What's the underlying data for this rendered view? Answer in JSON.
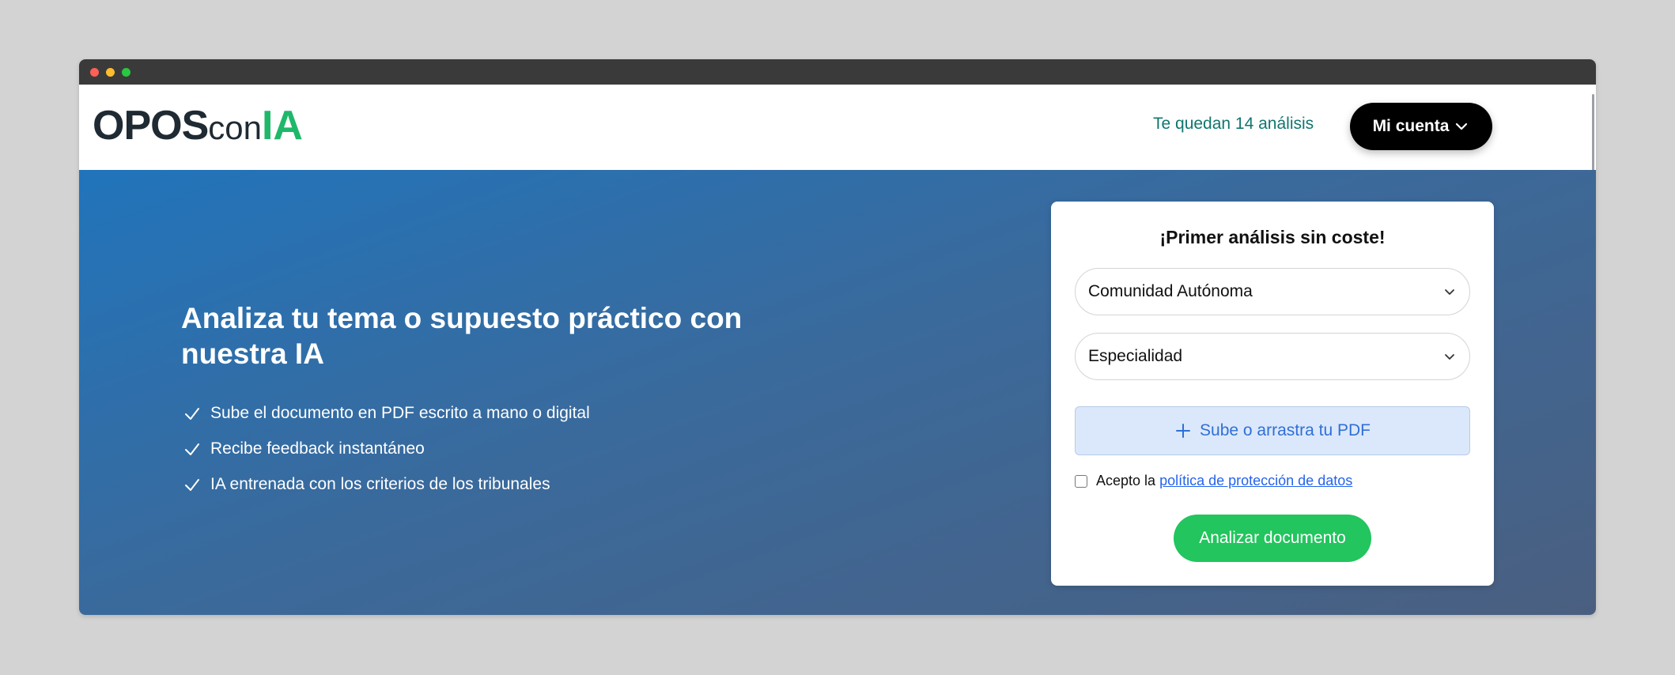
{
  "window": {
    "controls": [
      "close",
      "minimize",
      "maximize"
    ]
  },
  "header": {
    "logo": {
      "part1": "OPOS",
      "part2": "con",
      "part3": "IA",
      "part3_color": "#1fb86a"
    },
    "credits_text": "Te quedan 14 análisis",
    "account_button": "Mi cuenta",
    "account_icon": "chevron-down-icon"
  },
  "hero": {
    "title": "Analiza tu tema o supuesto práctico con nuestra IA",
    "features": [
      "Sube el documento en PDF escrito a mano o digital",
      "Recibe feedback instantáneo",
      "IA entrenada con los criterios de los tribunales"
    ],
    "feature_icon": "check-icon"
  },
  "card": {
    "title": "¡Primer análisis sin coste!",
    "select_region": "Comunidad Autónoma",
    "select_specialty": "Especialidad",
    "upload_label": "Sube o arrastra tu PDF",
    "upload_icon": "plus-icon",
    "consent_prefix": "Acepto la",
    "consent_link": "política de protección de datos",
    "submit_label": "Analizar documento"
  },
  "colors": {
    "accent_green": "#22c55e",
    "hero_blue": "#2174bb",
    "link_blue": "#2563eb",
    "credits_teal": "#0f766e"
  }
}
